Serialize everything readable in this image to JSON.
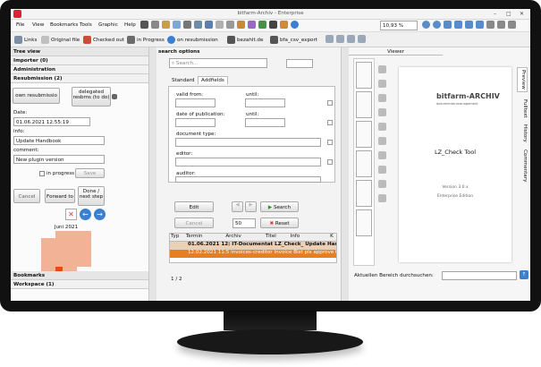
{
  "window": {
    "title": "bitfarm-Archiv - Enterprise"
  },
  "menu": [
    "File",
    "View",
    "Bookmarks",
    "Tools",
    "Graphic",
    "Help"
  ],
  "zoom": "10,93 %",
  "toolbar2": {
    "links": "Links",
    "original": "Original file",
    "checked": "Checked out",
    "progress": "in Progress",
    "resub": "on resubmission",
    "bezahlt": "bezahlt.de",
    "bfa": "bfa_csv_export"
  },
  "left": {
    "tree_view": "Tree view",
    "importer": "Importer (0)",
    "administration": "Administration",
    "resubmission": "Resubmission (2)",
    "own_btn": "own resubmissio",
    "delegated_btn": "delegated resbms (to do)",
    "date_label": "Date:",
    "date_value": "01.06.2021 12:55:19",
    "info_label": "info:",
    "info_value": "Update Handbook",
    "comment_label": "comment:",
    "comment_value": "New plugin version",
    "in_progress": "in progress",
    "save": "Save",
    "cancel": "Cancel",
    "forward": "Forward to",
    "done": "Done / next step",
    "cal_month": "Juni 2021",
    "bookmarks": "Bookmarks",
    "workspace": "Workspace (1)"
  },
  "mid": {
    "header": "search options",
    "search_placeholder": "Search...",
    "tab_standard": "Standard",
    "tab_addfields": "Addfields",
    "valid_from": "valid from:",
    "until1": "until:",
    "pub_date": "date of publication:",
    "until2": "until:",
    "doc_type": "document type:",
    "editor": "editor:",
    "auditor": "auditor:",
    "edit": "Edit",
    "search": "Search",
    "cancel": "Cancel",
    "count": "50",
    "reset": "Reset",
    "cols": [
      "Typ",
      "Termin",
      "Archiv",
      "Titel",
      "Info",
      "K"
    ],
    "row1": "01.06.2021 12: IT-Documentat LZ_Check_ Update Handbook B",
    "row2": "12.02.2021 11:5 invoices-creditor Invoice Bist pls approve this invoi",
    "pager": "1 / 2"
  },
  "right": {
    "viewer": "Viewer",
    "side_tabs": [
      "Preview",
      "Fulltext",
      "History",
      "Commentary"
    ],
    "logo": "bitfarm-ARCHIV",
    "logo_sub": "dokumentenmanagement",
    "doc_title": "LZ_Check Tool",
    "version": "Version 3.0.x",
    "edition": "Enterprise Edition",
    "search_label": "Aktuellen Bereich durchsuchen:"
  }
}
